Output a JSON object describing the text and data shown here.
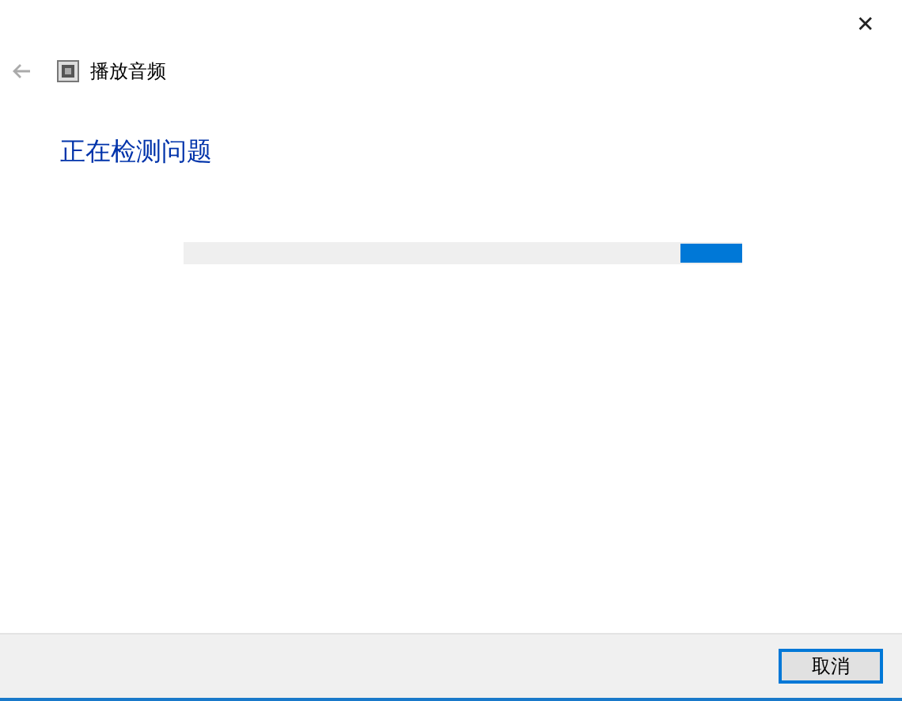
{
  "window": {
    "close_glyph": "✕"
  },
  "nav": {
    "back_disabled": true,
    "title": "播放音频"
  },
  "heading": "正在检测问题",
  "progress": {
    "indeterminate": true
  },
  "buttons": [
    {
      "label": "取消",
      "selected": true
    }
  ]
}
